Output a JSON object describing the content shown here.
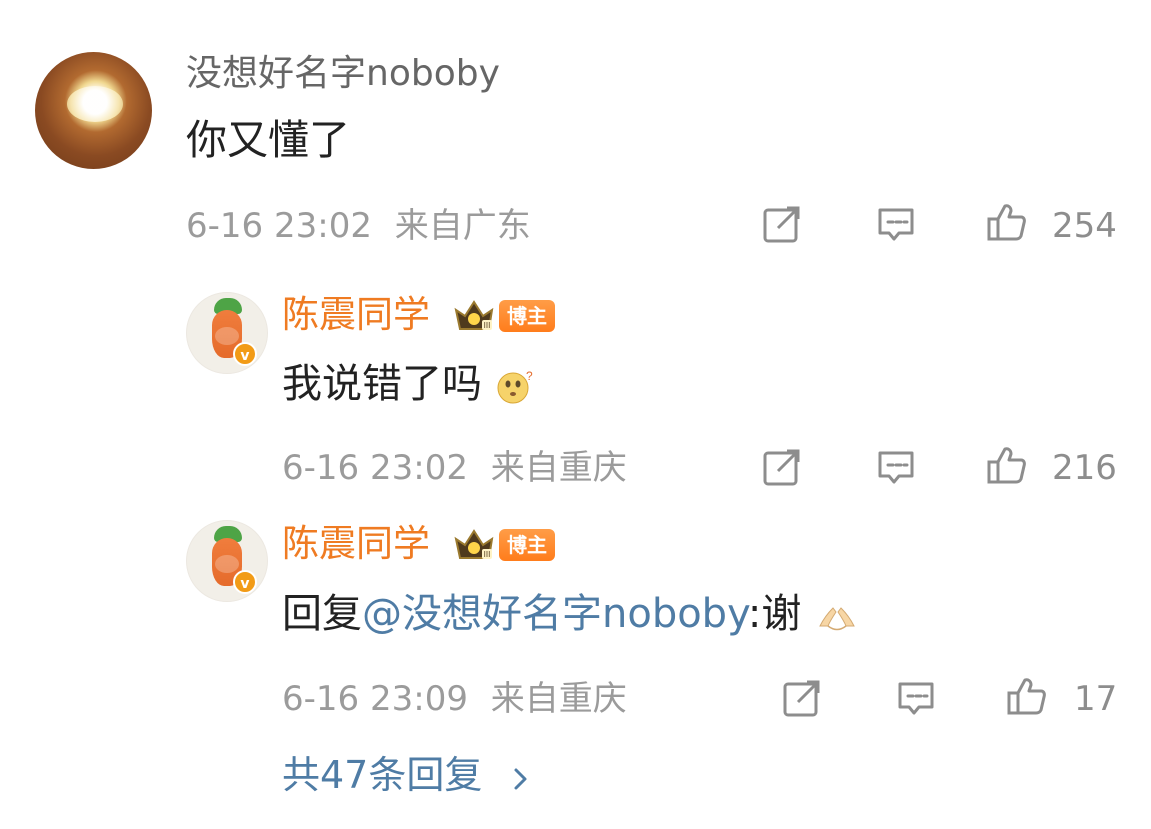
{
  "comment": {
    "username": "没想好名字noboby",
    "content": "你又懂了",
    "timestamp": "6-16 23:02",
    "location": "来自广东",
    "likes": "254"
  },
  "replies": [
    {
      "username": "陈震同学",
      "badge_label": "博主",
      "content": "我说错了吗",
      "timestamp": "6-16 23:02",
      "location": "来自重庆",
      "likes": "216"
    },
    {
      "username": "陈震同学",
      "badge_label": "博主",
      "content_prefix": "回复",
      "mention": "@没想好名字noboby",
      "content_suffix": ":谢",
      "timestamp": "6-16 23:09",
      "location": "来自重庆",
      "likes": "17"
    }
  ],
  "more_replies_label": "共47条回复",
  "icons": {
    "share": "share-icon",
    "comment": "comment-icon",
    "like": "thumbs-up-icon",
    "chevron": "chevron-right-icon"
  },
  "colors": {
    "accent_orange": "#ef7b22",
    "link_blue": "#4f7ca5",
    "meta_gray": "#9b9b9b"
  }
}
